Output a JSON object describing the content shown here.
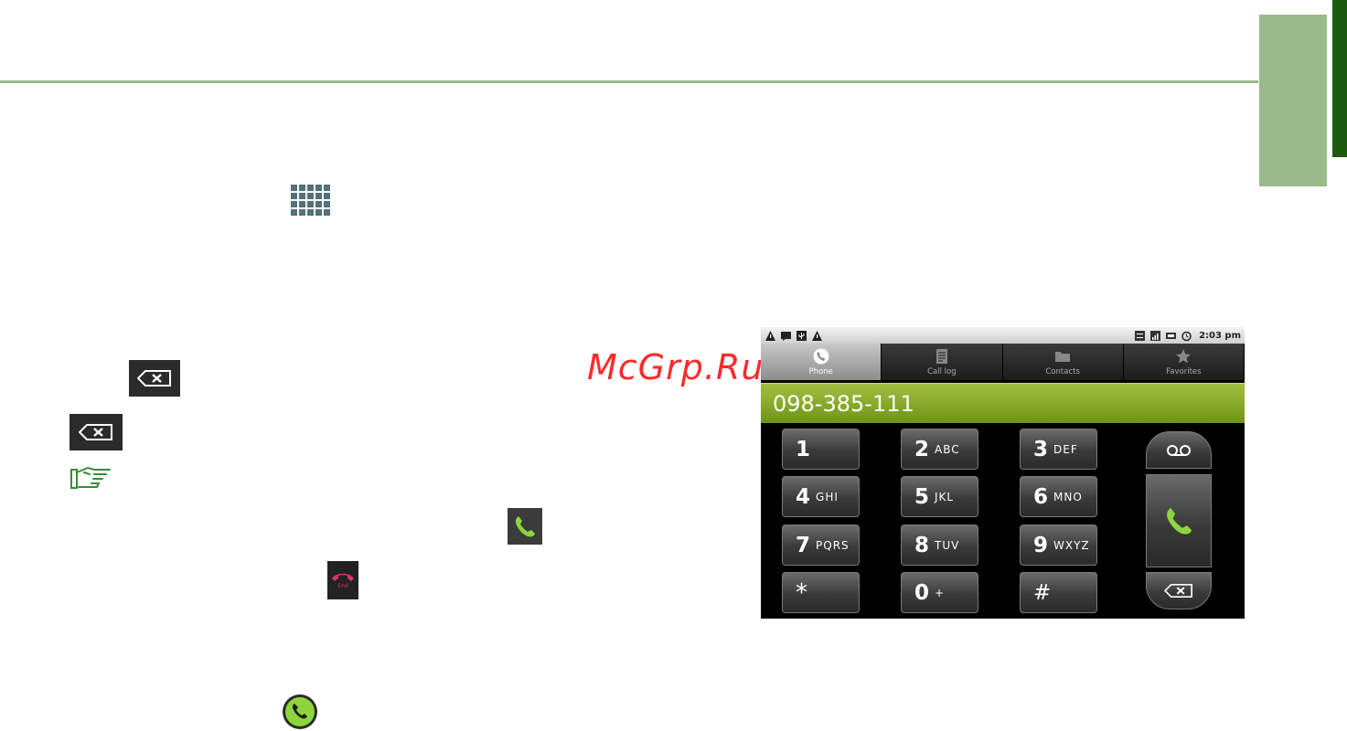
{
  "watermark": "McGrp.Ru",
  "icons": {
    "grid": "app-grid-icon",
    "backspace": "backspace-icon",
    "hand": "pointing-hand-icon",
    "call": "call-icon",
    "end_call": "end-call-icon"
  },
  "end_chip_label": "End",
  "phone": {
    "status_bar": {
      "left_icons": [
        "warning-icon",
        "message-icon",
        "usb-icon",
        "warning-icon"
      ],
      "right_icons": [
        "3g-icon",
        "signal-icon",
        "battery-icon",
        "alarm-icon"
      ],
      "time": "2:03 pm"
    },
    "tabs": [
      {
        "label": "Phone",
        "icon": "phone-icon",
        "active": true
      },
      {
        "label": "Call log",
        "icon": "call-log-icon",
        "active": false
      },
      {
        "label": "Contacts",
        "icon": "contacts-icon",
        "active": false
      },
      {
        "label": "Favorites",
        "icon": "star-icon",
        "active": false
      }
    ],
    "number": "098-385-111",
    "keys": [
      {
        "digit": "1",
        "letters": ""
      },
      {
        "digit": "2",
        "letters": "ABC"
      },
      {
        "digit": "3",
        "letters": "DEF"
      },
      {
        "digit": "4",
        "letters": "GHI"
      },
      {
        "digit": "5",
        "letters": "JKL"
      },
      {
        "digit": "6",
        "letters": "MNO"
      },
      {
        "digit": "7",
        "letters": "PQRS"
      },
      {
        "digit": "8",
        "letters": "TUV"
      },
      {
        "digit": "9",
        "letters": "WXYZ"
      },
      {
        "digit": "*",
        "letters": ""
      },
      {
        "digit": "0",
        "letters": "+"
      },
      {
        "digit": "#",
        "letters": ""
      }
    ],
    "side_buttons": [
      "voicemail-icon",
      "dial-icon",
      "backspace-icon"
    ],
    "colors": {
      "number_bar": "#8cb02c",
      "call_green": "#8ed43c",
      "end_red": "#e0306a"
    }
  }
}
